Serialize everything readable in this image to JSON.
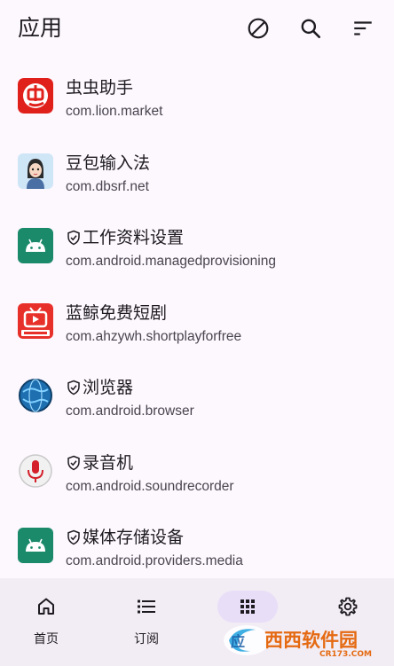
{
  "header": {
    "title": "应用",
    "actions": [
      "block-icon",
      "search-icon",
      "sort-icon"
    ]
  },
  "apps": [
    {
      "name": "虫虫助手",
      "package": "com.lion.market",
      "system": false,
      "icon": "chongchong-icon"
    },
    {
      "name": "豆包输入法",
      "package": "com.dbsrf.net",
      "system": false,
      "icon": "doubao-avatar-icon"
    },
    {
      "name": "工作资料设置",
      "package": "com.android.managedprovisioning",
      "system": true,
      "icon": "android-icon"
    },
    {
      "name": "蓝鲸免费短剧",
      "package": "com.ahzywh.shortplayforfree",
      "system": false,
      "icon": "tv-icon"
    },
    {
      "name": "浏览器",
      "package": "com.android.browser",
      "system": true,
      "icon": "globe-icon"
    },
    {
      "name": "录音机",
      "package": "com.android.soundrecorder",
      "system": true,
      "icon": "microphone-icon"
    },
    {
      "name": "媒体存储设备",
      "package": "com.android.providers.media",
      "system": true,
      "icon": "android-icon"
    }
  ],
  "nav": {
    "items": [
      {
        "label": "首页",
        "icon": "home-icon",
        "active": false
      },
      {
        "label": "订阅",
        "icon": "list-icon",
        "active": false
      },
      {
        "label": "应用",
        "icon": "apps-grid-icon",
        "active": true
      },
      {
        "label": "",
        "icon": "gear-icon",
        "active": false
      }
    ]
  },
  "watermark": {
    "text": "西西软件园",
    "domain": "CR173.COM"
  },
  "colors": {
    "background": "#fdf7fe",
    "navbar": "#f2ecf4",
    "active_pill": "#e8def8",
    "android_green": "#1b8a6b",
    "chongchong_red": "#e0201b"
  }
}
